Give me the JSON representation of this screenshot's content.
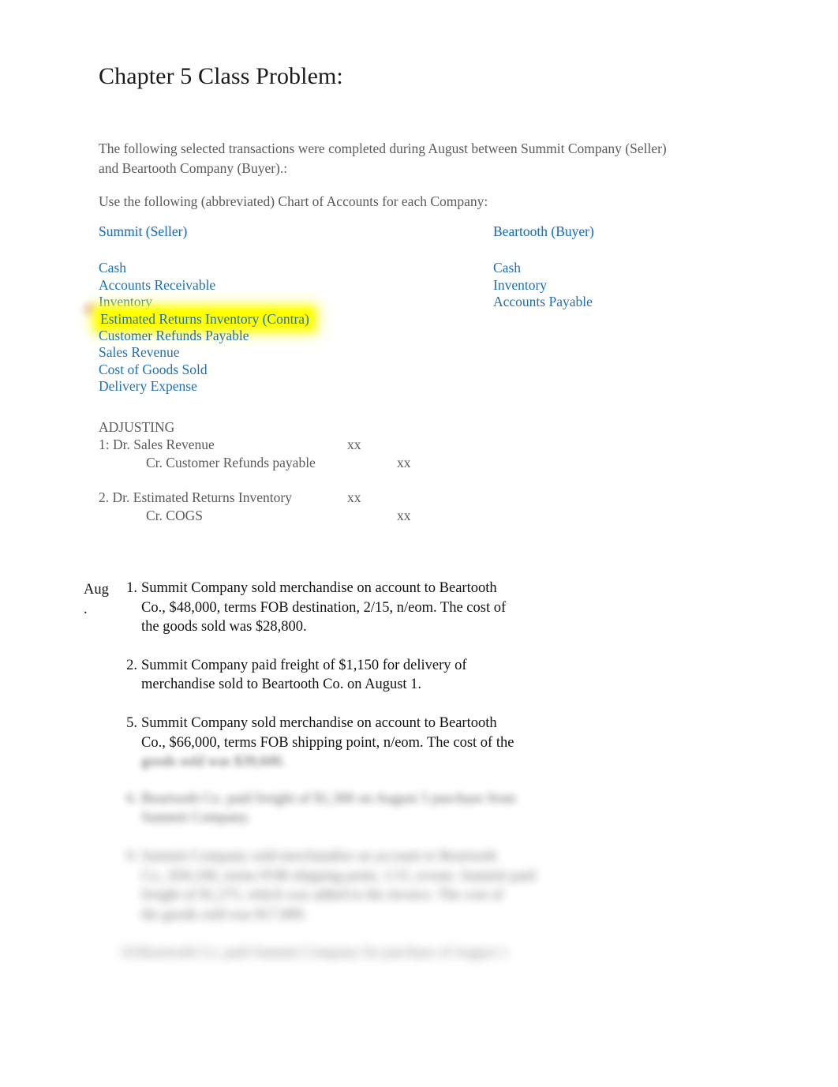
{
  "document": {
    "title": "Chapter 5 Class Problem:",
    "intro_paragraph_1": "The following selected transactions were completed during August between Summit Company (Seller) and Beartooth Company (Buyer).:",
    "intro_paragraph_2": "Use the following (abbreviated) Chart of Accounts for each Company:"
  },
  "colors": {
    "account_link": "#1f6fb5",
    "highlight": "#ffff00",
    "body_gray": "#5a5a5a",
    "transaction_black": "#111111",
    "page_background": "#ffffff"
  },
  "chart_of_accounts": {
    "seller": {
      "heading": "Summit (Seller)",
      "accounts": [
        {
          "label": "Cash",
          "highlighted": false
        },
        {
          "label": "Accounts Receivable",
          "highlighted": false
        },
        {
          "label": "Inventory",
          "highlighted": false
        },
        {
          "label": "Estimated Returns Inventory (Contra)",
          "highlighted": true
        },
        {
          "label": "Customer Refunds Payable",
          "highlighted": false
        },
        {
          "label": "Sales Revenue",
          "highlighted": false
        },
        {
          "label": "Cost of Goods Sold",
          "highlighted": false
        },
        {
          "label": "Delivery Expense",
          "highlighted": false
        }
      ]
    },
    "buyer": {
      "heading": "Beartooth (Buyer)",
      "accounts": [
        {
          "label": "Cash",
          "highlighted": false
        },
        {
          "label": "Inventory",
          "highlighted": false
        },
        {
          "label": "Accounts Payable",
          "highlighted": false
        }
      ]
    }
  },
  "adjusting": {
    "label": "ADJUSTING",
    "entries": [
      {
        "number": "1:",
        "debit_line": {
          "account": "1: Dr. Sales Revenue",
          "amount": "xx"
        },
        "credit_line": {
          "account": "Cr. Customer Refunds payable",
          "amount": "xx"
        }
      },
      {
        "number": "2.",
        "debit_line": {
          "account": "2. Dr. Estimated Returns Inventory",
          "amount": "xx"
        },
        "credit_line": {
          "account": "Cr. COGS",
          "amount": "xx"
        }
      }
    ]
  },
  "transactions": {
    "month_label": "Aug",
    "month_label_continuation": ".",
    "items": [
      {
        "number": "1.",
        "blur": "b0",
        "lines": [
          "Summit Company sold merchandise on account to Beartooth",
          "Co., $48,000, terms FOB destination, 2/15, n/eom. The cost of",
          "the goods sold was $28,800."
        ]
      },
      {
        "number": "2.",
        "blur": "b0",
        "lines": [
          "Summit Company paid freight of $1,150 for delivery of",
          "merchandise sold to Beartooth Co. on August 1."
        ]
      },
      {
        "number": "5.",
        "blur": "b0",
        "lines": [
          "Summit Company sold merchandise on account to Beartooth",
          "Co., $66,000, terms FOB shipping point, n/eom. The cost of the"
        ]
      }
    ],
    "obscured_items": [
      {
        "blur": "b1",
        "lines": [
          "goods sold was $39,600."
        ]
      },
      {
        "number": "6.",
        "blur": "b2",
        "lines": [
          "Beartooth Co. paid freight of $1,300 on August 5 purchase from",
          "Summit Company."
        ]
      },
      {
        "number": "9.",
        "blur": "b3",
        "lines": [
          "Summit Company sold merchandise on account to Beartooth",
          "Co., $30,100, terms FOB shipping point, 1/15, n/eom. Summit paid",
          "freight of $1,275, which was added to the invoice. The cost of",
          "the goods sold was $17,000."
        ]
      },
      {
        "blur": "b4",
        "lines": [
          "10.Beartooth Co. paid Summit Company for purchase of August 1."
        ]
      }
    ]
  }
}
